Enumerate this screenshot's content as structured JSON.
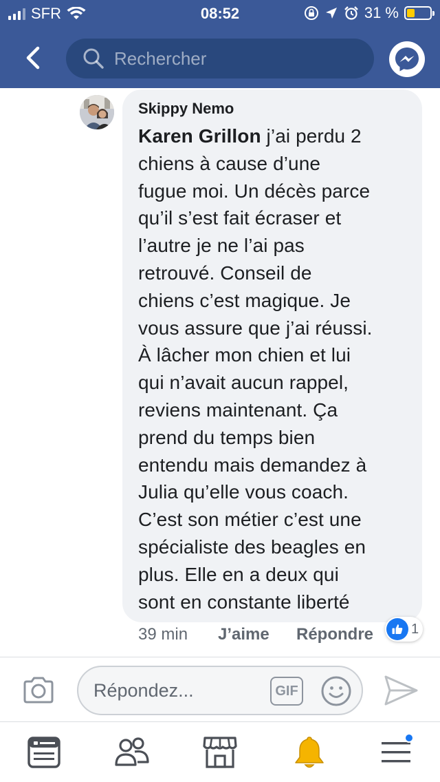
{
  "status_bar": {
    "carrier": "SFR",
    "time": "08:52",
    "battery": "31 %",
    "battery_level": 0.31,
    "signal_bars": 3
  },
  "header": {
    "search_placeholder": "Rechercher"
  },
  "comment": {
    "author": "Skippy Nemo",
    "mention": "Karen Grillon",
    "lines": [
      " j’ai perdu 2",
      "chiens à cause d’une",
      "fugue moi. Un décès parce",
      "qu’il s’est fait écraser et",
      "l’autre je ne l’ai pas",
      "retrouvé. Conseil de",
      "chiens c’est magique. Je",
      "vous assure que j’ai réussi.",
      "À lâcher mon chien et lui",
      "qui n’avait aucun rappel,",
      "reviens maintenant. Ça",
      "prend du temps bien",
      "entendu mais demandez à",
      "Julia qu’elle vous coach.",
      "C’est son métier c’est une",
      "spécialiste des beagles en",
      "plus. Elle en a deux qui",
      "sont en constante liberté"
    ],
    "time": "39 min",
    "like_label": "J’aime",
    "reply_label": "Répondre",
    "reaction_count": "1"
  },
  "reply_bar": {
    "placeholder": "Répondez...",
    "gif_label": "GIF"
  },
  "colors": {
    "header": "#3b5998",
    "search": "#29487d",
    "bubble": "#f0f2f5",
    "accent": "#1877f2",
    "bell": "#f5b400"
  },
  "icons": {
    "back": "chevron-left-icon",
    "search": "search-icon",
    "messenger": "messenger-icon",
    "camera": "camera-icon",
    "emoji": "smiley-icon",
    "send": "send-icon",
    "tabs": [
      "news-feed-icon",
      "friends-icon",
      "marketplace-icon",
      "notifications-bell-icon",
      "menu-icon"
    ]
  }
}
